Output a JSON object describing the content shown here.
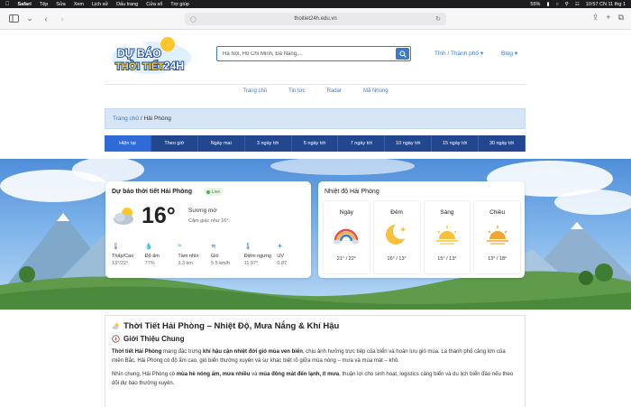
{
  "menubar": {
    "app": "Safari",
    "items": [
      "Tệp",
      "Sửa",
      "Xem",
      "Lịch sử",
      "Dấu trang",
      "Cửa sổ",
      "Trợ giúp"
    ],
    "battery": "55%",
    "clock": "10:57 CN 11 thg 1"
  },
  "browser": {
    "url": "thoitiet24h.edu.vn"
  },
  "header": {
    "logo_line1": "DỰ BÁO",
    "logo_line2": "THỜI TIẾT",
    "logo_badge": "24H",
    "search_placeholder": "Hà Nội, Hồ Chí Minh, Đà Nẵng,...",
    "city_link": "Tỉnh / Thành phố",
    "blog_link": "Blog"
  },
  "nav": [
    "Trang chủ",
    "Tin tức",
    "Radar",
    "Mã Nhúng"
  ],
  "breadcrumb": {
    "home": "Trang chủ",
    "sep": " / ",
    "current": "Hải Phòng"
  },
  "tabs": [
    "Hiện tại",
    "Theo giờ",
    "Ngày mai",
    "3 ngày tới",
    "5 ngày tới",
    "7 ngày tới",
    "10 ngày tới",
    "15 ngày tới",
    "30 ngày tới"
  ],
  "current": {
    "title": "Dự báo thời tiết Hải Phòng",
    "live": "Live",
    "temp": "16°",
    "condition": "Sương mờ",
    "feels": "Cảm giác như 16°.",
    "metrics": [
      {
        "icon": "thermometer-icon",
        "label": "Thấp/Cao",
        "value": "13°/22°"
      },
      {
        "icon": "humidity-icon",
        "label": "Độ ẩm",
        "value": "77%"
      },
      {
        "icon": "visibility-icon",
        "label": "Tầm nhìn",
        "value": "3.3 km"
      },
      {
        "icon": "wind-icon",
        "label": "Gió",
        "value": "5.5 km/h"
      },
      {
        "icon": "dewpoint-icon",
        "label": "Điểm ngưng",
        "value": "11.97°"
      },
      {
        "icon": "uv-icon",
        "label": "UV",
        "value": "0.87"
      }
    ]
  },
  "periods": {
    "title": "Nhiệt độ Hải Phòng",
    "items": [
      {
        "name": "Ngày",
        "icon": "rainbow-icon",
        "temp": "21° / 22°"
      },
      {
        "name": "Đêm",
        "icon": "moon-icon",
        "temp": "16° / 13°"
      },
      {
        "name": "Sáng",
        "icon": "sunrise-icon",
        "temp": "15° / 13°"
      },
      {
        "name": "Chiều",
        "icon": "sunset-icon",
        "temp": "13° / 18°"
      }
    ]
  },
  "article": {
    "title": "Thời Tiết Hải Phòng – Nhiệt Độ, Mưa Nắng & Khí Hậu",
    "subtitle": "Giới Thiệu Chung",
    "p1_a": "Thời tiết Hải Phòng",
    "p1_b": " mang đặc trưng ",
    "p1_c": "khí hậu cận nhiệt đới gió mùa ven biển",
    "p1_d": ", chịu ảnh hưởng trực tiếp của biển và hoàn lưu gió mùa. Là thành phố cảng lớn của miền Bắc, Hải Phòng có độ ẩm cao, gió biển thường xuyên và sự khác biệt rõ giữa mùa nóng – mưa và mùa mát – khô.",
    "p2_a": "Nhìn chung, Hải Phòng có ",
    "p2_b": "mùa hè nóng ẩm, mưa nhiều",
    "p2_c": " và ",
    "p2_d": "mùa đông mát đến lạnh, ít mưa",
    "p2_e": ", thuận lợi cho sinh hoạt, logistics cảng biển và du lịch biển đảo nếu theo dõi dự báo thường xuyên."
  },
  "colors": {
    "accent": "#3a7bc8",
    "tabs_bg": "#23478f",
    "tab_active": "#2f6ad9",
    "breadcrumb_bg": "#d6e6f7"
  }
}
